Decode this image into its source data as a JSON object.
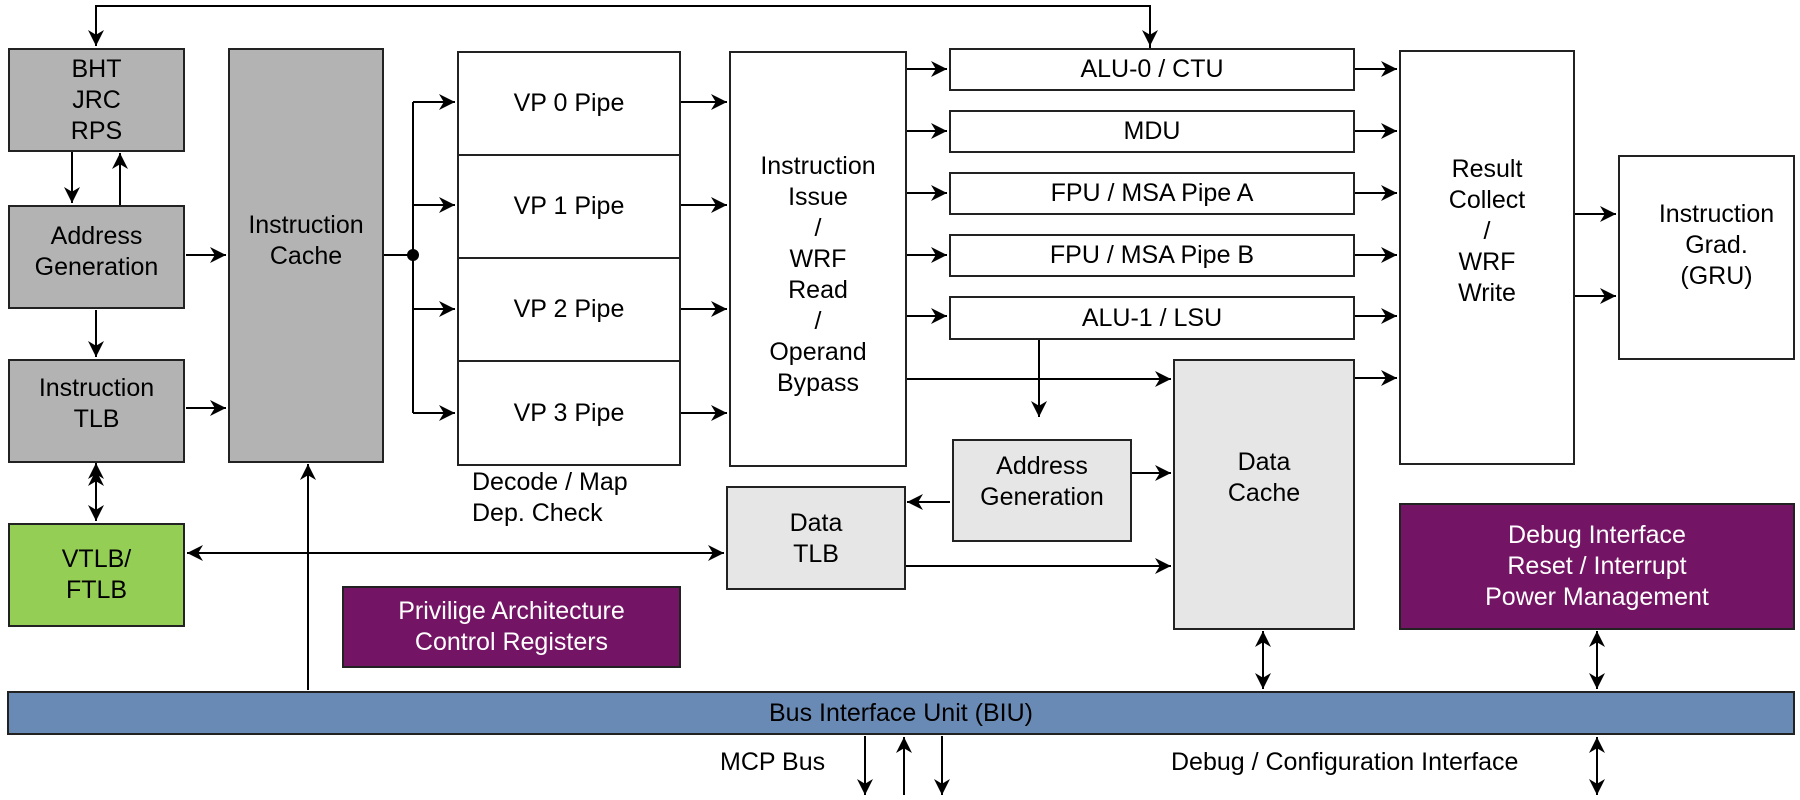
{
  "diagram": {
    "frontend": {
      "bht": [
        "BHT",
        "JRC",
        "RPS"
      ],
      "address_generation": [
        "Address",
        "Generation"
      ],
      "instruction_tlb": [
        "Instruction",
        "TLB"
      ],
      "vtlb": [
        "VTLB/",
        "FTLB"
      ],
      "instruction_cache": [
        "Instruction",
        "Cache"
      ]
    },
    "decode": {
      "pipes": [
        "VP 0 Pipe",
        "VP 1 Pipe",
        "VP 2 Pipe",
        "VP 3 Pipe"
      ],
      "caption": [
        "Decode / Map",
        "Dep. Check"
      ]
    },
    "issue": [
      "Instruction",
      "Issue",
      "/",
      "WRF",
      "Read",
      "/",
      "Operand",
      "Bypass"
    ],
    "execution_units": [
      "ALU-0 / CTU",
      "MDU",
      "FPU / MSA Pipe A",
      "FPU / MSA Pipe B",
      "ALU-1 / LSU"
    ],
    "result_collect": [
      "Result",
      "Collect",
      "/",
      "WRF",
      "Write"
    ],
    "graduation": [
      "Instruction",
      "Grad.",
      "(GRU)"
    ],
    "data_cache": [
      "Data",
      "Cache"
    ],
    "data_address_generation": [
      "Address",
      "Generation"
    ],
    "data_tlb": [
      "Data",
      "TLB"
    ],
    "privilege": [
      "Privilige Architecture",
      "Control Registers"
    ],
    "debug": [
      "Debug Interface",
      "Reset / Interrupt",
      "Power Management"
    ],
    "biu": "Bus Interface Unit (BIU)",
    "mcp_bus": "MCP Bus",
    "debug_config": "Debug / Configuration Interface"
  },
  "colors": {
    "dark_gray_block": "#b3b3b3",
    "light_gray_block": "#e6e6e6",
    "green_block": "#95ce55",
    "purple_block": "#741464",
    "bus_blue": "#6a8ab6"
  }
}
